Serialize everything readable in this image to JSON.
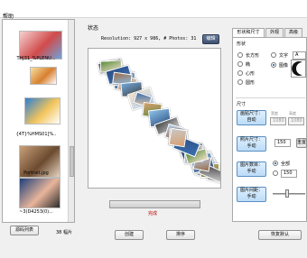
{
  "menu": {
    "help_label": "帮助"
  },
  "files": [
    {
      "label": "",
      "colors": [
        "#f4d2d0",
        "#d14b4b",
        "#6fa3d8"
      ]
    },
    {
      "label": "THJ31_%PLENU...",
      "colors": [
        "#f5e1a0",
        "#d88030",
        "#ffffff"
      ]
    },
    {
      "label": "{4T}%HMS01]%..",
      "colors": [
        "#2e7fd0",
        "#f2c55c",
        "#ffffff"
      ]
    },
    {
      "label": "Portrait.jpg",
      "colors": [
        "#c9a07a",
        "#6b4a2f",
        "#e6d3c0"
      ]
    },
    {
      "label": "~3(D4253(0)...",
      "colors": [
        "#1e3e7a",
        "#e8b59a",
        "#2c2c2c"
      ]
    }
  ],
  "file_list_button": "源码列表",
  "file_count": "38 幅片",
  "status": {
    "title": "状态",
    "resolution": "Resolution: 927 x 986, # Photos: 31",
    "edit_button": "编辑",
    "done_text": "完成",
    "progress": 1.0
  },
  "bottom": {
    "create_button": "创建",
    "sort_button": "排序",
    "default_button": "恢复默认"
  },
  "tabs": [
    "形状和尺寸",
    "外观",
    "高级"
  ],
  "shape": {
    "group_label": "形状",
    "options": [
      "长方形",
      "椭",
      "心形",
      "圆形"
    ],
    "text_label": "文字",
    "text_value": "A",
    "image_label": "图像"
  },
  "size": {
    "group_label": "尺寸",
    "canvas_button": "画贴尺寸：\n自动",
    "width_label": "宽度",
    "height_label": "高度",
    "width_value": "1080",
    "height_value": "1080",
    "photo_button": "照片尺寸：\n手动",
    "photo_value": "150",
    "photo_apply": "重置",
    "count_button": "图片数目：\n手动",
    "count_all": "全部",
    "count_value": "150",
    "spacing_button": "图片间距：\n手动"
  }
}
